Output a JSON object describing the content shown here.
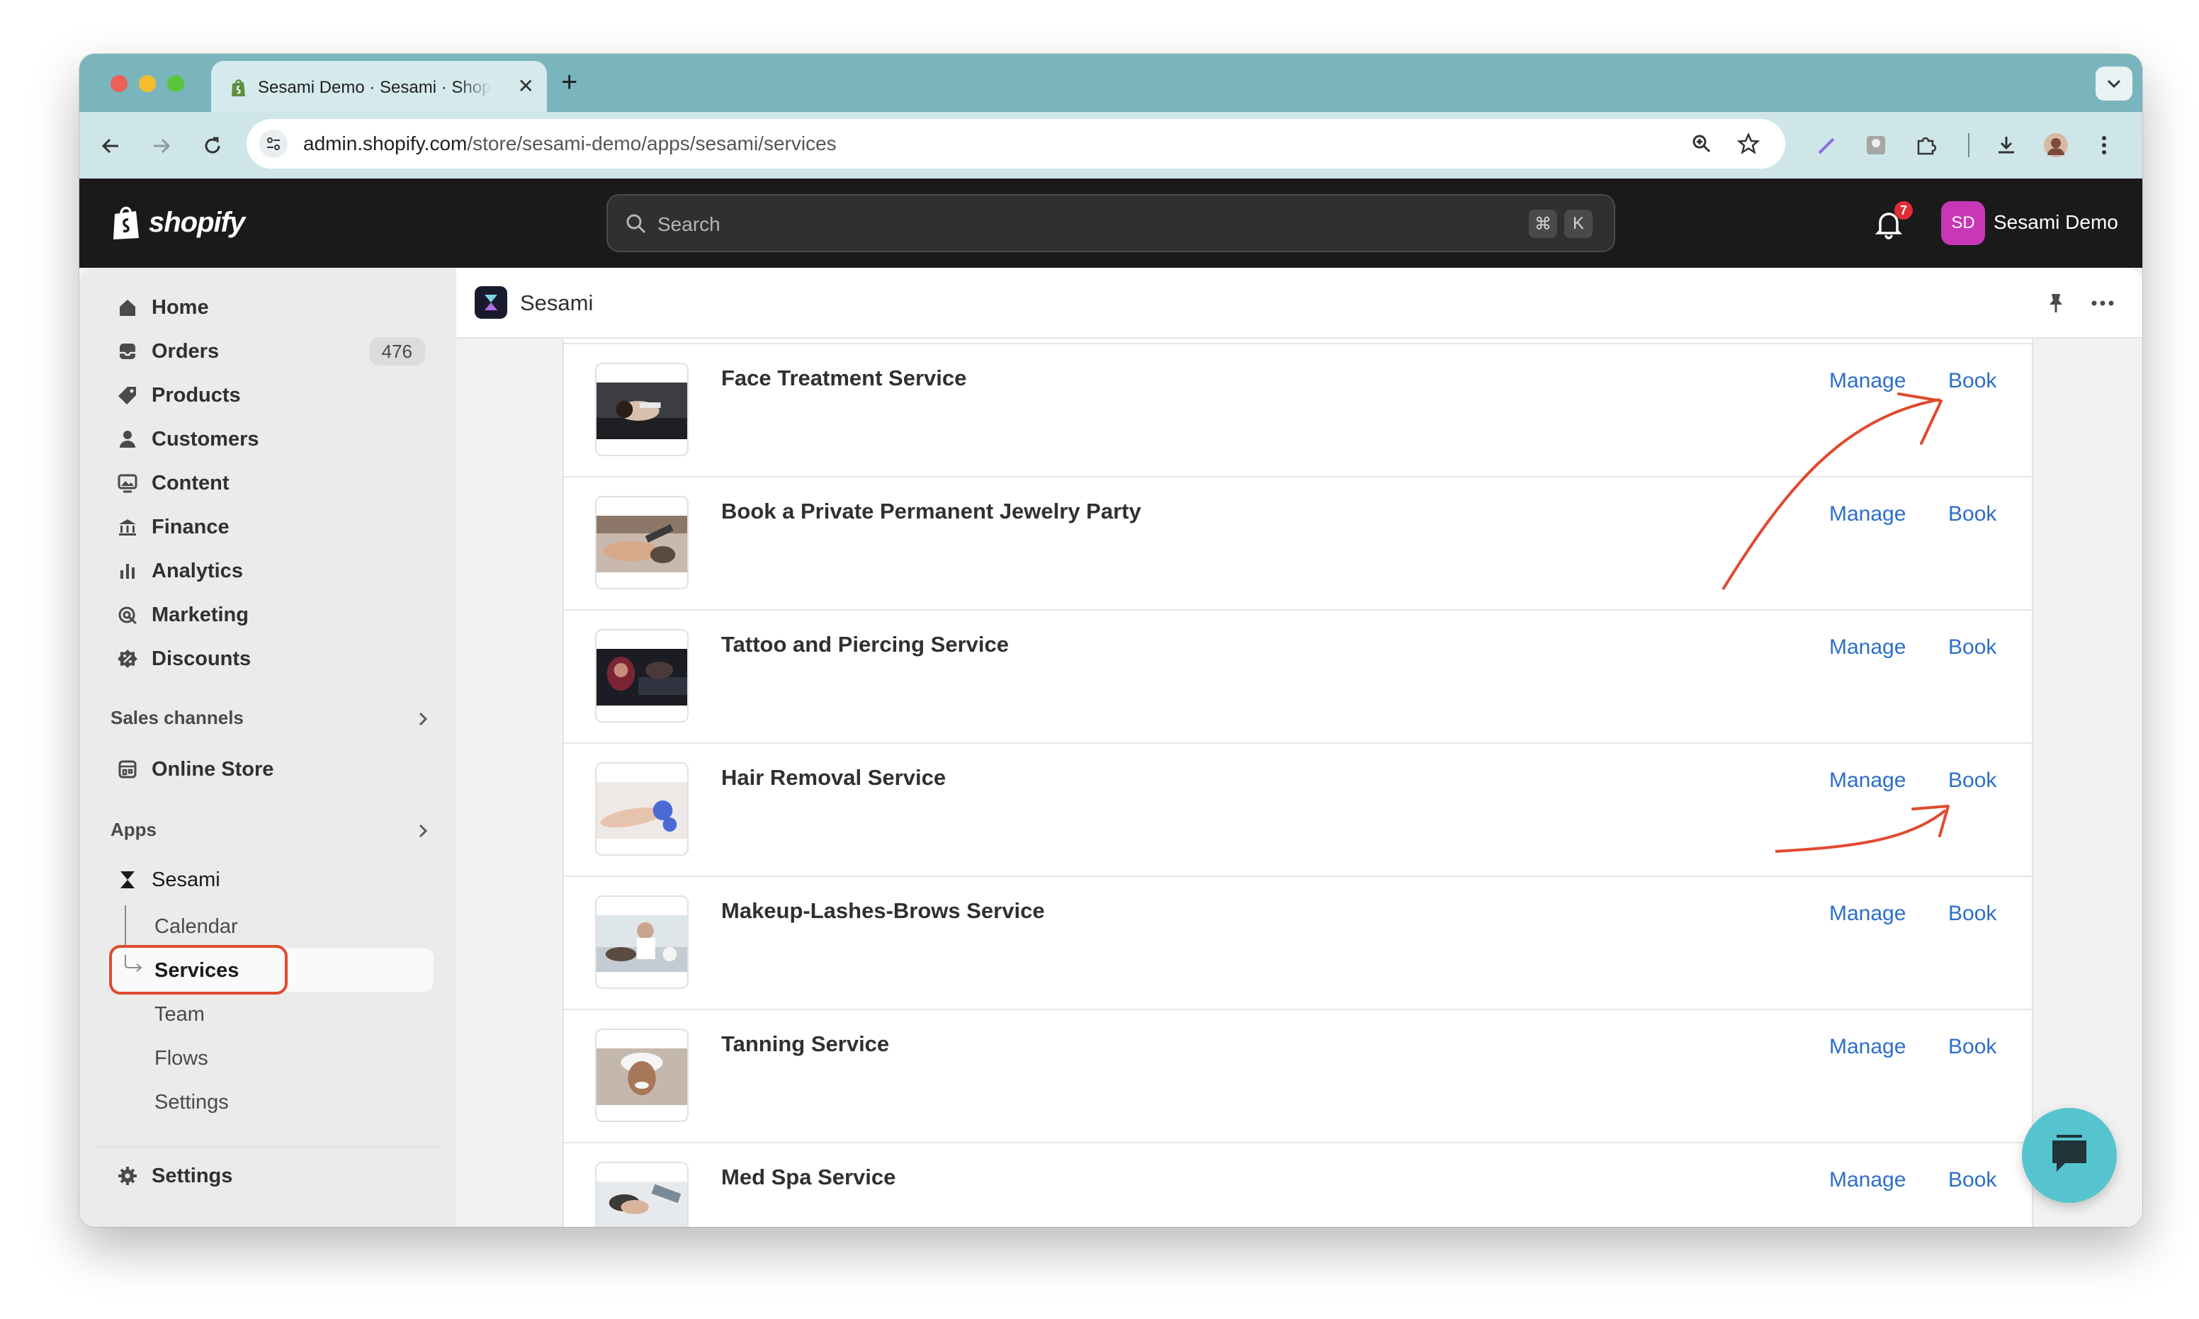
{
  "browser": {
    "tab_title": "Sesami Demo · Sesami · Shopify",
    "url_host": "admin.shopify.com",
    "url_path": "/store/sesami-demo/apps/sesami/services"
  },
  "topbar": {
    "logo_text": "shopify",
    "search_placeholder": "Search",
    "shortcut_cmd": "⌘",
    "shortcut_key": "K",
    "notification_count": "7",
    "avatar_initials": "SD",
    "store_name": "Sesami Demo"
  },
  "sidebar": {
    "items": [
      {
        "label": "Home",
        "icon": "home-icon"
      },
      {
        "label": "Orders",
        "icon": "orders-icon",
        "count": "476"
      },
      {
        "label": "Products",
        "icon": "tag-icon"
      },
      {
        "label": "Customers",
        "icon": "person-icon"
      },
      {
        "label": "Content",
        "icon": "content-icon"
      },
      {
        "label": "Finance",
        "icon": "bank-icon"
      },
      {
        "label": "Analytics",
        "icon": "bar-chart-icon"
      },
      {
        "label": "Marketing",
        "icon": "target-icon"
      },
      {
        "label": "Discounts",
        "icon": "discount-icon"
      }
    ],
    "sales_channels_label": "Sales channels",
    "online_store_label": "Online Store",
    "apps_label": "Apps",
    "app_name": "Sesami",
    "app_sub_items": [
      "Calendar",
      "Services",
      "Team",
      "Flows",
      "Settings"
    ],
    "settings_label": "Settings"
  },
  "app_header": {
    "title": "Sesami"
  },
  "services": [
    {
      "name": "Face Treatment Service",
      "manage": "Manage",
      "book": "Book"
    },
    {
      "name": "Book a Private Permanent Jewelry Party",
      "manage": "Manage",
      "book": "Book"
    },
    {
      "name": "Tattoo and Piercing Service",
      "manage": "Manage",
      "book": "Book"
    },
    {
      "name": "Hair Removal Service",
      "manage": "Manage",
      "book": "Book"
    },
    {
      "name": "Makeup-Lashes-Brows Service",
      "manage": "Manage",
      "book": "Book"
    },
    {
      "name": "Tanning Service",
      "manage": "Manage",
      "book": "Book"
    },
    {
      "name": "Med Spa Service",
      "manage": "Manage",
      "book": "Book"
    }
  ],
  "colors": {
    "link": "#2c6ecb",
    "annotation": "#e04a2f",
    "topbar": "#1a1a1a",
    "browser_chrome": "#7ab5bd",
    "chat": "#55c4cf"
  }
}
